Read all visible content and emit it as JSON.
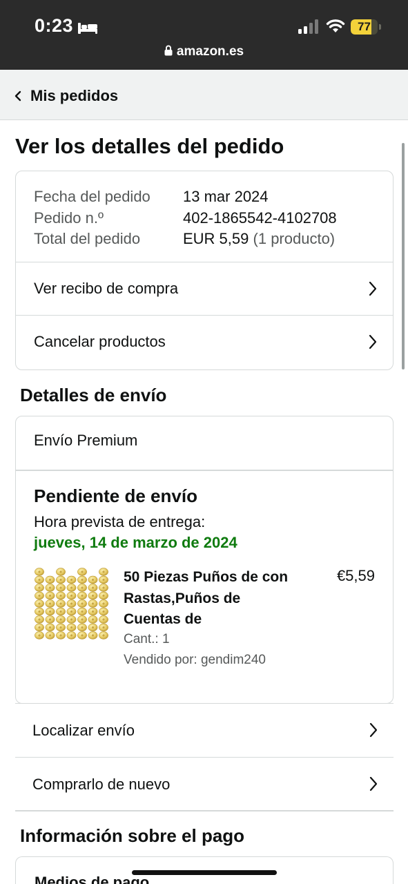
{
  "status_bar": {
    "time": "0:23",
    "battery_level": "77",
    "battery_fraction": 0.77,
    "url": "amazon.es",
    "icons": [
      "bed-icon",
      "cellular-signal-icon",
      "wifi-icon",
      "battery-icon",
      "lock-icon"
    ]
  },
  "nav": {
    "back_label": "Mis pedidos"
  },
  "page": {
    "title": "Ver los detalles del pedido"
  },
  "order_summary": {
    "date_label": "Fecha del pedido",
    "date_value": "13 mar 2024",
    "number_label": "Pedido n.º",
    "number_value": "402-1865542-4102708",
    "total_label": "Total del pedido",
    "total_value": "EUR 5,59",
    "total_count": "(1 producto)"
  },
  "order_actions": {
    "receipt": "Ver recibo de compra",
    "cancel": "Cancelar productos"
  },
  "shipping": {
    "section_title": "Detalles de envío",
    "type": "Envío Premium",
    "status": "Pendiente de envío",
    "eta_label": "Hora prevista de entrega:",
    "eta_date": "jueves, 14 de marzo de 2024",
    "eta_color": "#0f7b0f",
    "product": {
      "title": "50 Piezas Puños de con Rastas,Puños de Cuentas de",
      "price": "€5,59",
      "quantity": "Cant.: 1",
      "seller": "Vendido por: gendim240"
    },
    "track": "Localizar envío",
    "buy_again": "Comprarlo de nuevo"
  },
  "payment": {
    "section_title": "Información sobre el pago",
    "methods_label": "Medios de pago"
  }
}
